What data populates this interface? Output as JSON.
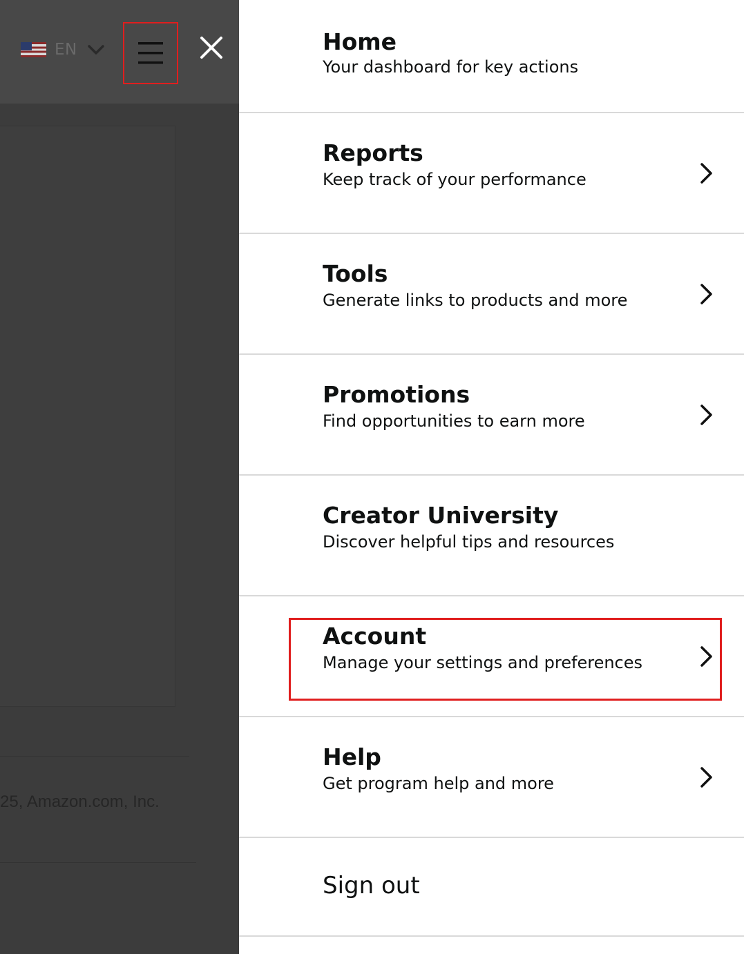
{
  "header": {
    "language": {
      "flag": "us-flag-icon",
      "label": "EN"
    },
    "icons": {
      "menu": "hamburger-menu-icon",
      "close": "close-icon",
      "dropdown": "chevron-down-icon"
    }
  },
  "background": {
    "footer_copyright": "25, Amazon.com, Inc."
  },
  "menu": {
    "items": [
      {
        "title": "Home",
        "description": "Your dashboard for key actions",
        "has_submenu": false
      },
      {
        "title": "Reports",
        "description": "Keep track of your performance",
        "has_submenu": true
      },
      {
        "title": "Tools",
        "description": "Generate links to products and more",
        "has_submenu": true
      },
      {
        "title": "Promotions",
        "description": "Find opportunities to earn more",
        "has_submenu": true
      },
      {
        "title": "Creator University",
        "description": "Discover helpful tips and resources",
        "has_submenu": false
      },
      {
        "title": "Account",
        "description": "Manage your settings and preferences",
        "has_submenu": true
      },
      {
        "title": "Help",
        "description": "Get program help and more",
        "has_submenu": true
      }
    ],
    "sign_out": "Sign out"
  },
  "colors": {
    "highlight": "#e01e1e",
    "overlay": "#3c3c3c",
    "drawer_bg": "#ffffff",
    "text": "#0f1111"
  }
}
